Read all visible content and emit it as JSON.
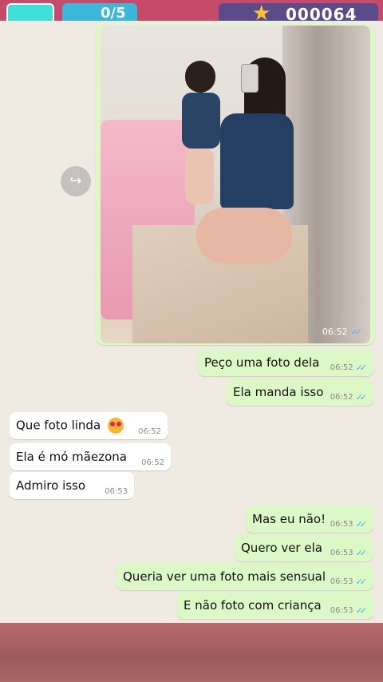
{
  "overlay": {
    "progress": "0/5",
    "score": "000064"
  },
  "photo_message": {
    "time": "06:52",
    "ticks": "✓✓"
  },
  "messages": [
    {
      "side": "out",
      "text": "Peço uma foto dela",
      "time": "06:52",
      "ticks": "✓✓"
    },
    {
      "side": "out",
      "text": "Ela manda isso",
      "time": "06:52",
      "ticks": "✓✓"
    },
    {
      "side": "in",
      "text": "Que foto linda",
      "emoji": "heart-eyes-emoji",
      "time": "06:52"
    },
    {
      "side": "in",
      "text": "Ela é mó mãezona",
      "time": "06:52"
    },
    {
      "side": "in",
      "text": "Admiro isso",
      "time": "06:53"
    },
    {
      "side": "out",
      "text": "Mas eu não!",
      "time": "06:53",
      "ticks": "✓✓"
    },
    {
      "side": "out",
      "text": "Quero ver ela",
      "time": "06:53",
      "ticks": "✓✓"
    },
    {
      "side": "out",
      "text": "Queria ver uma foto mais sensual",
      "time": "06:53",
      "ticks": "✓✓"
    },
    {
      "side": "out",
      "text": "E não foto com criança",
      "time": "06:53",
      "ticks": "✓✓"
    }
  ],
  "colors": {
    "outgoing_bubble": "#dcf8c6",
    "incoming_bubble": "#ffffff",
    "chat_background": "#efeae2",
    "read_tick": "#4fb6ec"
  },
  "icons": [
    "forward-icon",
    "double-check-icon",
    "star-icon"
  ]
}
